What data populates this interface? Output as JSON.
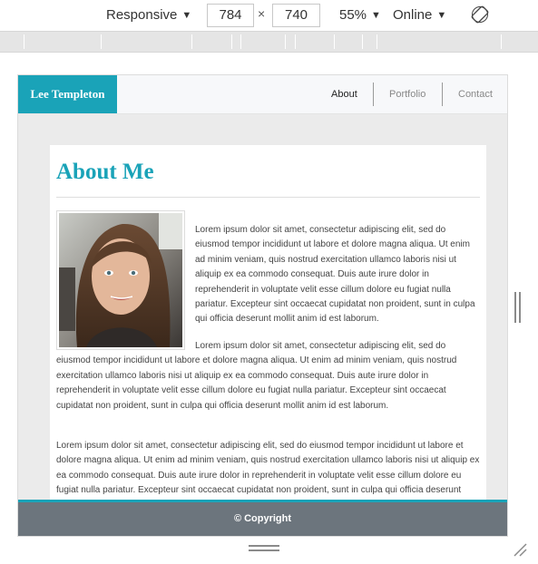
{
  "devtools": {
    "device_label": "Responsive",
    "width_value": "784",
    "height_value": "740",
    "times_symbol": "×",
    "zoom_label": "55%",
    "network_label": "Online",
    "icons": {
      "device_caret": "chevron-down-icon",
      "zoom_caret": "chevron-down-icon",
      "network_caret": "chevron-down-icon",
      "rotate": "rotate-icon"
    }
  },
  "site": {
    "brand": "Lee Templeton",
    "nav": [
      {
        "label": "About"
      },
      {
        "label": "Portfolio"
      },
      {
        "label": "Contact"
      }
    ],
    "page_title": "About Me",
    "paragraphs": [
      "Lorem ipsum dolor sit amet, consectetur adipiscing elit, sed do eiusmod tempor incididunt ut labore et dolore magna aliqua. Ut enim ad minim veniam, quis nostrud exercitation ullamco laboris nisi ut aliquip ex ea commodo consequat. Duis aute irure dolor in reprehenderit in voluptate velit esse cillum dolore eu fugiat nulla pariatur. Excepteur sint occaecat cupidatat non proident, sunt in culpa qui officia deserunt mollit anim id est laborum.",
      "Lorem ipsum dolor sit amet, consectetur adipiscing elit, sed do eiusmod tempor incididunt ut labore et dolore magna aliqua. Ut enim ad minim veniam, quis nostrud exercitation ullamco laboris nisi ut aliquip ex ea commodo consequat. Duis aute irure dolor in reprehenderit in voluptate velit esse cillum dolore eu fugiat nulla pariatur. Excepteur sint occaecat cupidatat non proident, sunt in culpa qui officia deserunt mollit anim id est laborum.",
      "Lorem ipsum dolor sit amet, consectetur adipiscing elit, sed do eiusmod tempor incididunt ut labore et dolore magna aliqua. Ut enim ad minim veniam, quis nostrud exercitation ullamco laboris nisi ut aliquip ex ea commodo consequat. Duis aute irure dolor in reprehenderit in voluptate velit esse cillum dolore eu fugiat nulla pariatur. Excepteur sint occaecat cupidatat non proident, sunt in culpa qui officia deserunt mollit anim id est laborum."
    ],
    "footer": "© Copyright"
  },
  "colors": {
    "accent": "#1aa3b8",
    "footer_bg": "#6c757d",
    "viewport_bg": "#ebebeb",
    "ruler_bg": "#e5e5e5"
  }
}
